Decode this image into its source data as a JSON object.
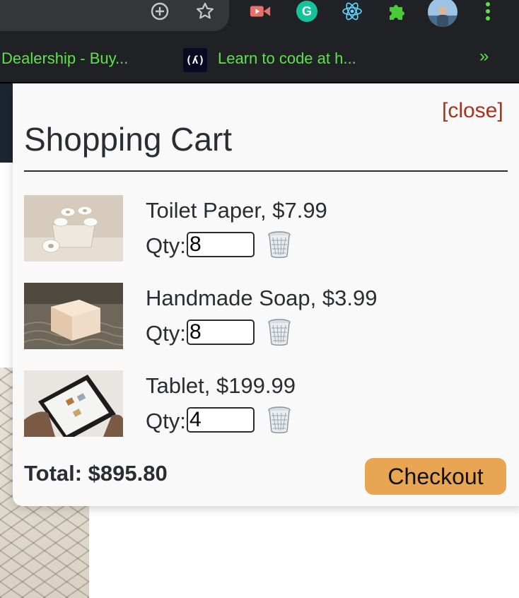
{
  "browser": {
    "bookmarks": [
      {
        "label": "Dealership - Buy..."
      },
      {
        "label": "Learn to code at h...",
        "icon_text": "(ʎ)"
      }
    ],
    "overflow_label": "»",
    "extension_icons": [
      "zoom-icon",
      "bookmark-star-icon",
      "video-extension-icon",
      "grammarly-icon",
      "react-devtools-icon",
      "extensions-puzzle-icon",
      "profile-avatar",
      "menu-kebab-icon"
    ]
  },
  "cart": {
    "close_label": "[close]",
    "title": "Shopping Cart",
    "qty_label": "Qty:",
    "items": [
      {
        "name": "Toilet Paper, $7.99",
        "qty": "8",
        "image": "toilet-paper-photo"
      },
      {
        "name": "Handmade Soap, $3.99",
        "qty": "8",
        "image": "soap-photo"
      },
      {
        "name": "Tablet, $199.99",
        "qty": "4",
        "image": "tablet-photo"
      }
    ],
    "total_label": "Total: $895.80",
    "checkout_label": "Checkout"
  },
  "colors": {
    "accent_link": "#a8321c",
    "checkout_button": "#e8a552",
    "bookmark_text": "#5ee24a"
  }
}
